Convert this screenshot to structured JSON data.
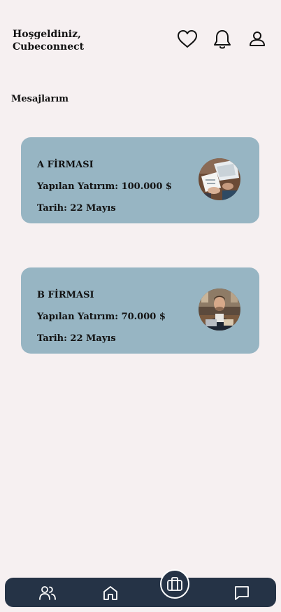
{
  "header": {
    "greeting_line1": "Hoşgeldiniz,",
    "greeting_line2": "Cubeconnect",
    "icons": [
      "heart-icon",
      "bell-icon",
      "user-icon"
    ]
  },
  "section": {
    "title": "Mesajlarım"
  },
  "messages": [
    {
      "company": "A FİRMASI",
      "investment": "Yapılan Yatırım: 100.000 $",
      "date": "Tarih: 22 Mayıs"
    },
    {
      "company": "B FİRMASI",
      "investment": "Yapılan Yatırım: 70.000 $",
      "date": "Tarih: 22 Mayıs"
    }
  ],
  "bottom_nav": {
    "items": [
      "users-icon",
      "home-icon",
      "briefcase-icon",
      "chat-icon"
    ],
    "active": "briefcase-icon"
  },
  "colors": {
    "background": "#F6F0F1",
    "card": "#97B5C3",
    "nav": "#253346",
    "text": "#111111"
  }
}
